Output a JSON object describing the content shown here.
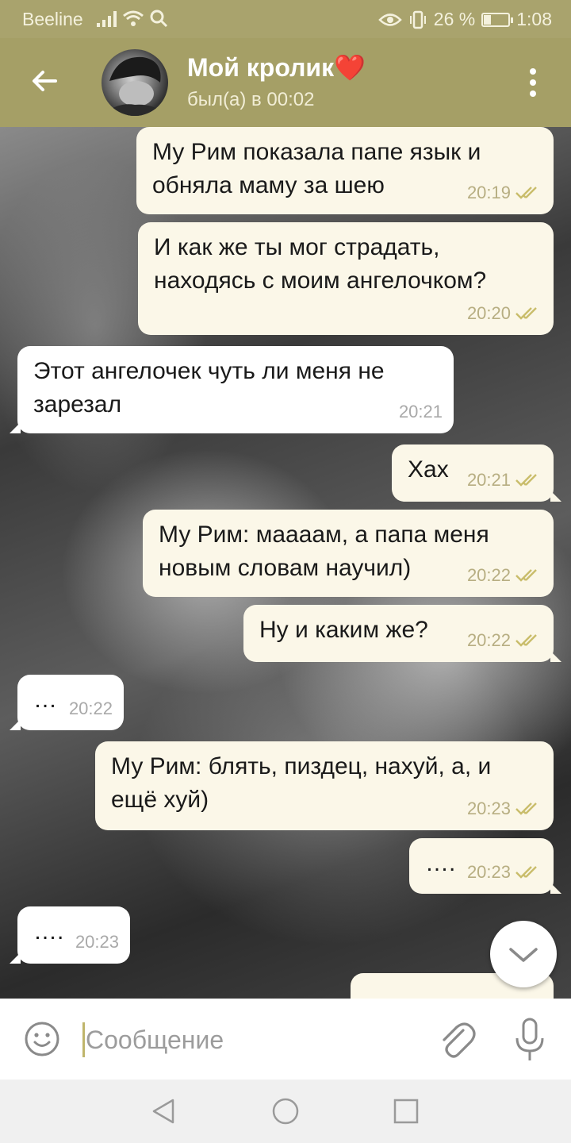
{
  "status": {
    "carrier": "Beeline",
    "battery": "26 %",
    "battery_level": 0.26,
    "time": "1:08"
  },
  "header": {
    "title": "Мой кролик❤️",
    "subtitle": "был(а) в 00:02"
  },
  "messages": [
    {
      "dir": "out",
      "text": "Му Рим показала папе язык и обняла маму за шею",
      "time": "20:19"
    },
    {
      "dir": "out",
      "text": "И как же ты мог страдать, находясь с моим ангелочком?",
      "time": "20:20"
    },
    {
      "dir": "in",
      "text": "Этот ангелочек чуть ли меня не зарезал",
      "time": "20:21"
    },
    {
      "dir": "out",
      "text": "Хах",
      "time": "20:21"
    },
    {
      "dir": "out",
      "text": "Му Рим: маааам, а папа меня новым словам научил)",
      "time": "20:22"
    },
    {
      "dir": "out",
      "text": "Ну и каким же?",
      "time": "20:22"
    },
    {
      "dir": "in",
      "text": "…",
      "time": "20:22"
    },
    {
      "dir": "out",
      "text": "Му Рим: блять, пиздец, нахуй, а, и ещё хуй)",
      "time": "20:23"
    },
    {
      "dir": "out",
      "text": "….",
      "time": "20:23"
    },
    {
      "dir": "in",
      "text": "….",
      "time": "20:23"
    }
  ],
  "input": {
    "placeholder": "Сообщение"
  },
  "colors": {
    "header": "#a59f66",
    "status_bar": "#a9a36d",
    "bubble_out": "#fbf7e8",
    "bubble_in": "#ffffff",
    "check": "#c9bd6b"
  },
  "icons": {
    "back": "arrow-left-icon",
    "menu": "more-vertical-icon",
    "emoji": "smiley-icon",
    "attach": "paperclip-icon",
    "mic": "microphone-icon",
    "read": "double-check-icon",
    "scroll": "chevron-down-icon"
  }
}
